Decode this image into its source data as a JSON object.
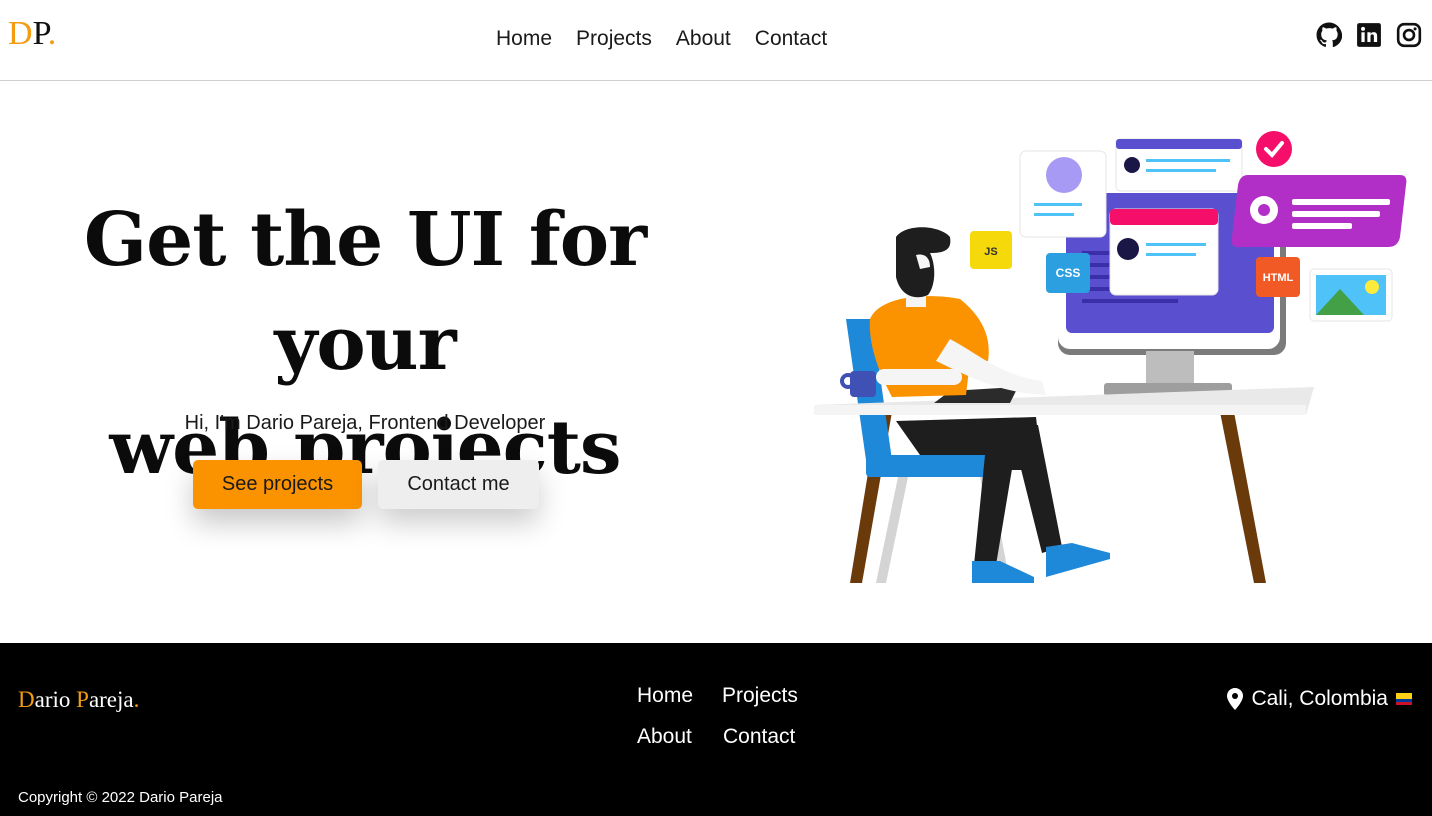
{
  "header": {
    "logo": {
      "d": "D",
      "p": "P",
      "dot": "."
    },
    "nav": [
      "Home",
      "Projects",
      "About",
      "Contact"
    ],
    "socials": [
      "github-icon",
      "linkedin-icon",
      "instagram-icon"
    ]
  },
  "hero": {
    "title_line1": "Get the UI for your",
    "title_line2": "web projects",
    "subtitle": "Hi, I'm Dario Pareja, Frontend Developer",
    "primary_button": "See projects",
    "secondary_button": "Contact me",
    "illustration_badges": [
      "JS",
      "CSS",
      "HTML"
    ]
  },
  "footer": {
    "logo": {
      "first_initial": "D",
      "first_rest": "ario ",
      "last_initial": "P",
      "last_rest": "areja",
      "dot": "."
    },
    "nav": [
      "Home",
      "Projects",
      "About",
      "Contact"
    ],
    "location": "Cali, Colombia",
    "copyright": "Copyright © 2022 Dario Pareja"
  },
  "colors": {
    "accent": "#fb9300",
    "logo_orange": "#f39c12",
    "footer_bg": "#000000"
  }
}
